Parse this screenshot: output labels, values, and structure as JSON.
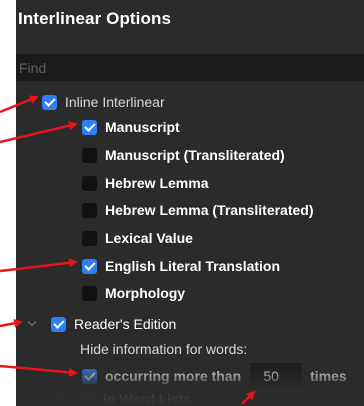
{
  "panel": {
    "title": "Interlinear Options",
    "find_placeholder": "Find"
  },
  "inline_interlinear": {
    "label": "Inline Interlinear",
    "checked": true,
    "items": [
      {
        "label": "Manuscript",
        "checked": true
      },
      {
        "label": "Manuscript (Transliterated)",
        "checked": false
      },
      {
        "label": "Hebrew Lemma",
        "checked": false
      },
      {
        "label": "Hebrew Lemma (Transliterated)",
        "checked": false
      },
      {
        "label": "Lexical Value",
        "checked": false
      },
      {
        "label": "English Literal Translation",
        "checked": true
      },
      {
        "label": "Morphology",
        "checked": false
      }
    ]
  },
  "readers_edition": {
    "label": "Reader's Edition",
    "checked": true,
    "hide_heading": "Hide information for words:",
    "occurring": {
      "label": "occurring more than",
      "checked": true,
      "value": "50",
      "suffix": "times"
    },
    "word_lists": {
      "label": "in Word Lists",
      "checked": false
    }
  },
  "colors": {
    "panel_bg": "#2b2b2b",
    "checkbox_on": "#2f7ef6",
    "annotation_arrow": "#e8141c"
  }
}
